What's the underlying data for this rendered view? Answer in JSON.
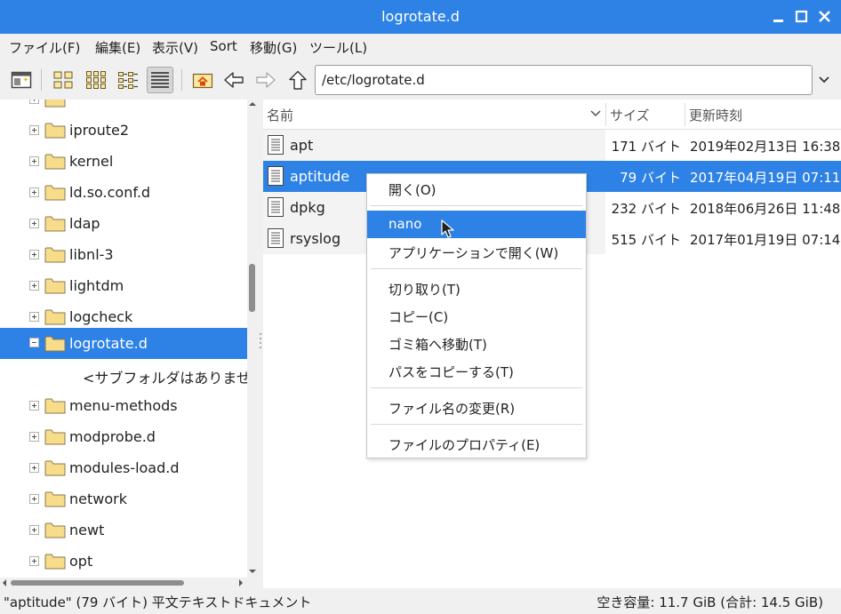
{
  "window": {
    "title": "logrotate.d"
  },
  "menubar": [
    {
      "label": "ファイル(F)"
    },
    {
      "label": "編集(E)"
    },
    {
      "label": "表示(V)"
    },
    {
      "label": "Sort"
    },
    {
      "label": "移動(G)"
    },
    {
      "label": "ツール(L)"
    }
  ],
  "toolbar": {
    "icons": [
      "new-window-icon",
      "icon-view-icon",
      "thumbnail-view-icon",
      "compact-view-icon",
      "detailed-list-view-icon",
      "home-icon",
      "back-icon",
      "forward-icon",
      "up-icon"
    ],
    "path": "/etc/logrotate.d"
  },
  "tree": {
    "items": [
      {
        "label": "iproute2"
      },
      {
        "label": "kernel"
      },
      {
        "label": "ld.so.conf.d"
      },
      {
        "label": "ldap"
      },
      {
        "label": "libnl-3"
      },
      {
        "label": "lightdm"
      },
      {
        "label": "logcheck"
      },
      {
        "label": "logrotate.d",
        "selected": true,
        "expanded": true
      },
      {
        "label": "<サブフォルダはありませ",
        "note": true
      },
      {
        "label": "menu-methods"
      },
      {
        "label": "modprobe.d"
      },
      {
        "label": "modules-load.d"
      },
      {
        "label": "network"
      },
      {
        "label": "newt"
      },
      {
        "label": "opt"
      }
    ]
  },
  "columns": {
    "name": "名前",
    "size": "サイズ",
    "modified": "更新時刻"
  },
  "files": [
    {
      "name": "apt",
      "size": "171 バイト",
      "date": "2019年02月13日 16:38"
    },
    {
      "name": "aptitude",
      "size": "79 バイト",
      "date": "2017年04月19日 07:11",
      "selected": true
    },
    {
      "name": "dpkg",
      "size": "232 バイト",
      "date": "2018年06月26日 11:48"
    },
    {
      "name": "rsyslog",
      "size": "515 バイト",
      "date": "2017年01月19日 07:14"
    }
  ],
  "context_menu": {
    "items": [
      {
        "label": "開く(O)"
      },
      {
        "label": "nano",
        "highlight": true
      },
      {
        "label": "アプリケーションで開く(W)"
      },
      {
        "label": "切り取り(T)"
      },
      {
        "label": "コピー(C)"
      },
      {
        "label": "ゴミ箱へ移動(T)"
      },
      {
        "label": "パスをコピーする(T)"
      },
      {
        "label": "ファイル名の変更(R)"
      },
      {
        "label": "ファイルのプロパティ(E)"
      }
    ]
  },
  "status": {
    "left": "\"aptitude\" (79 バイト) 平文テキストドキュメント",
    "right": "空き容量: 11.7 GiB (合計: 14.5 GiB)"
  },
  "colors": {
    "accent": "#2e82e5",
    "titlebar": "#2e82e5",
    "folder": "#f7dc8a"
  }
}
